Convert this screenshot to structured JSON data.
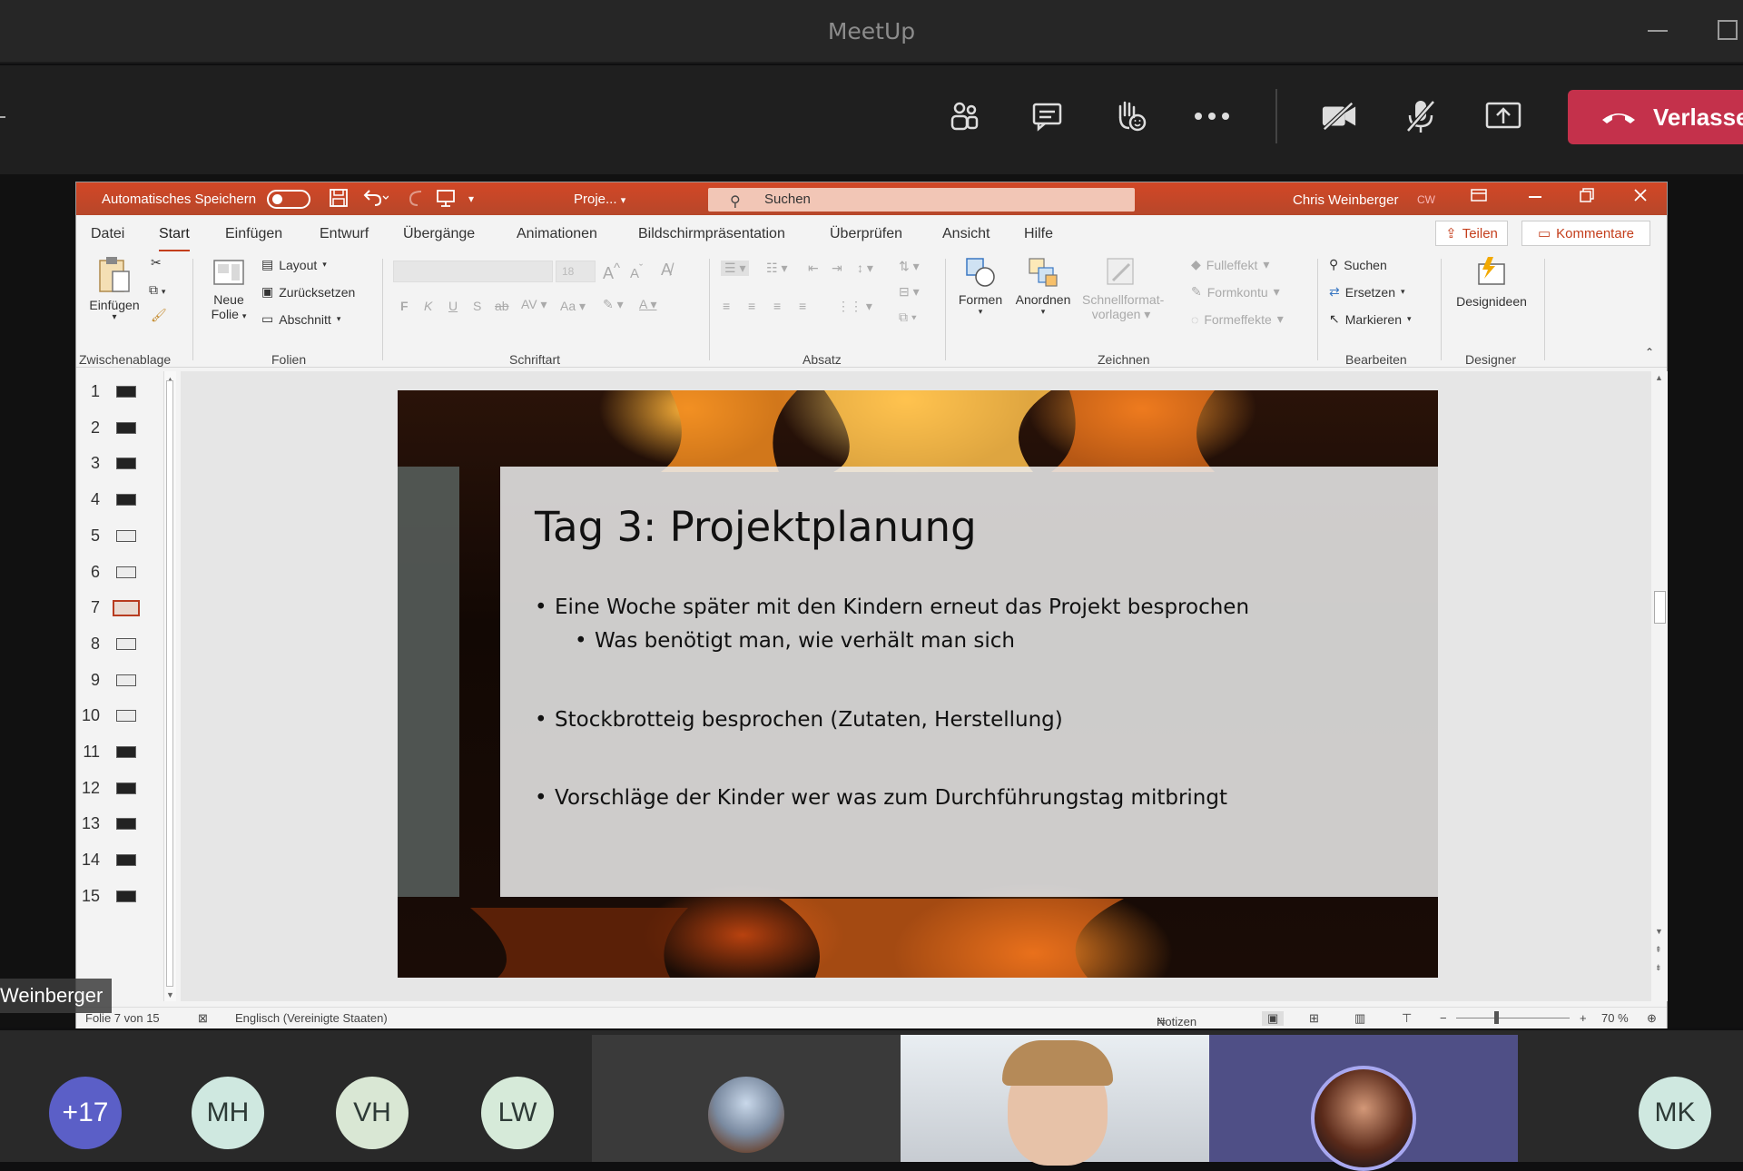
{
  "teams": {
    "title": "MeetUp",
    "leave_label": "Verlasse",
    "toolbar_icons": [
      "people-icon",
      "chat-icon",
      "raise-hand-icon",
      "more-icon",
      "camera-off-icon",
      "mic-off-icon",
      "share-screen-icon"
    ]
  },
  "ppt": {
    "autosave_label": "Automatisches Speichern",
    "doc_name": "Proje...",
    "search_placeholder": "Suchen",
    "user_name": "Chris Weinberger",
    "user_initials": "CW",
    "tabs": [
      "Datei",
      "Start",
      "Einfügen",
      "Entwurf",
      "Übergänge",
      "Animationen",
      "Bildschirmpräsentation",
      "Überprüfen",
      "Ansicht",
      "Hilfe"
    ],
    "active_tab": "Start",
    "share_label": "Teilen",
    "comments_label": "Kommentare",
    "ribbon": {
      "paste": "Einfügen",
      "clipboard_group": "Zwischenablage",
      "new_slide_line1": "Neue",
      "new_slide_line2": "Folie",
      "layout": "Layout",
      "reset": "Zurücksetzen",
      "section": "Abschnitt",
      "slides_group": "Folien",
      "font_group": "Schriftart",
      "paragraph_group": "Absatz",
      "shapes": "Formen",
      "arrange": "Anordnen",
      "quick_styles_1": "Schnellformat-",
      "quick_styles_2": "vorlagen",
      "fill": "Fulleffekt",
      "outline": "Formkontu",
      "effects": "Formeffekte",
      "drawing_group": "Zeichnen",
      "find": "Suchen",
      "replace": "Ersetzen",
      "select": "Markieren",
      "editing_group": "Bearbeiten",
      "design_ideas": "Designideen",
      "designer_group": "Designer",
      "font_size_placeholder": "18"
    },
    "slide_numbers": [
      "1",
      "2",
      "3",
      "4",
      "5",
      "6",
      "7",
      "8",
      "9",
      "10",
      "11",
      "12",
      "13",
      "14",
      "15"
    ],
    "selected_slide": "7",
    "slide": {
      "title": "Tag 3: Projektplanung",
      "bullet1": "Eine Woche später mit den Kindern erneut das Projekt besprochen",
      "bullet1_sub": "Was benötigt man, wie verhält man sich",
      "bullet2": "Stockbrotteig besprochen (Zutaten, Herstellung)",
      "bullet3": "Vorschläge der Kinder wer was zum Durchführungstag mitbringt"
    },
    "status": {
      "slide_of": "Folie 7 von 15",
      "language": "Englisch (Vereinigte Staaten)",
      "notes": "Notizen",
      "zoom": "70 %"
    }
  },
  "presenter_name_tag": "Weinberger",
  "participants": [
    {
      "label": "+17",
      "color": "#5b5fc7"
    },
    {
      "label": "MH",
      "color": "#cfe8e0"
    },
    {
      "label": "VH",
      "color": "#d9e7d4"
    },
    {
      "label": "LW",
      "color": "#d6ead9"
    },
    {
      "label": "MK",
      "color": "#cfe8e0"
    }
  ]
}
